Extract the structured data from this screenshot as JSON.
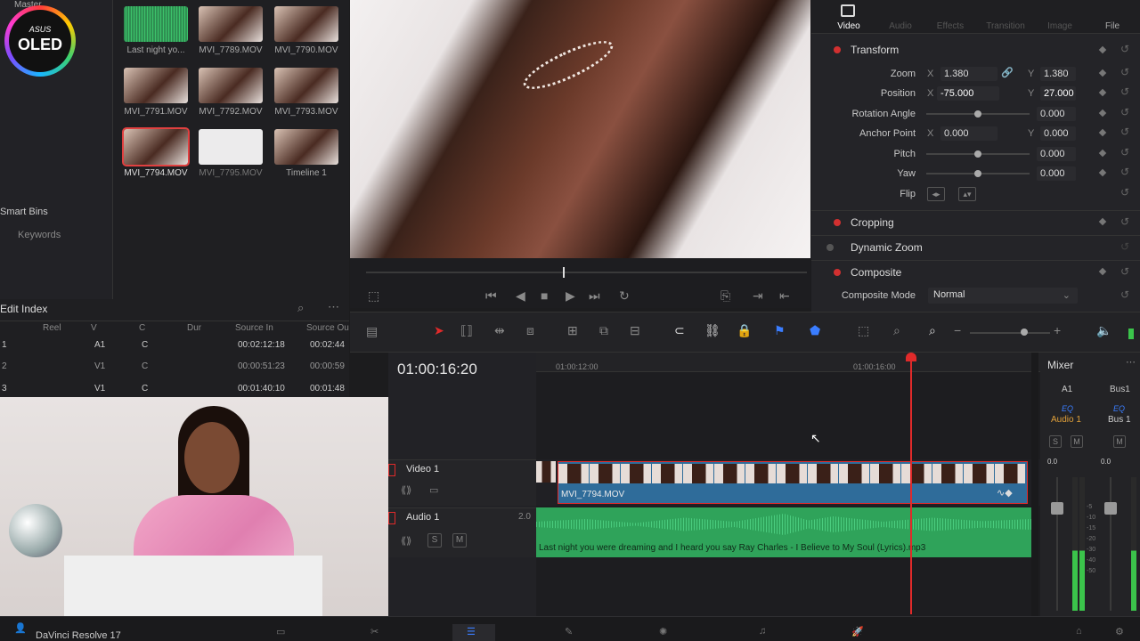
{
  "logo": {
    "brand": "ASUS",
    "product": "OLED"
  },
  "media_pool": {
    "header": "Master",
    "clips": [
      {
        "name": "Last night yo...",
        "kind": "audio"
      },
      {
        "name": "MVI_7789.MOV",
        "kind": "video"
      },
      {
        "name": "MVI_7790.MOV",
        "kind": "video"
      },
      {
        "name": "MVI_7791.MOV",
        "kind": "video"
      },
      {
        "name": "MVI_7792.MOV",
        "kind": "video"
      },
      {
        "name": "MVI_7793.MOV",
        "kind": "video"
      },
      {
        "name": "MVI_7794.MOV",
        "kind": "video",
        "selected": true
      },
      {
        "name": "MVI_7795.MOV",
        "kind": "white"
      },
      {
        "name": "Timeline 1",
        "kind": "timeline"
      }
    ],
    "smart_bins": "Smart Bins",
    "keywords": "Keywords"
  },
  "edit_index": {
    "title": "Edit Index",
    "columns": [
      "Reel",
      "V",
      "C",
      "Dur",
      "Source In",
      "Source Ou"
    ],
    "rows": [
      {
        "n": "1",
        "v": "A1",
        "c": "C",
        "in": "00:02:12:18",
        "out": "00:02:44"
      },
      {
        "n": "2",
        "v": "V1",
        "c": "C",
        "in": "00:00:51:23",
        "out": "00:00:59"
      },
      {
        "n": "3",
        "v": "V1",
        "c": "C",
        "in": "00:01:40:10",
        "out": "00:01:48"
      }
    ]
  },
  "inspector": {
    "tabs": [
      "Video",
      "Audio",
      "Effects",
      "Transition",
      "Image",
      "File"
    ],
    "active_tab": "Video",
    "transform": "Transform",
    "zoom": {
      "label": "Zoom",
      "x": "1.380",
      "y": "1.380"
    },
    "position": {
      "label": "Position",
      "x": "-75.000",
      "y": "27.000"
    },
    "rotation": {
      "label": "Rotation Angle",
      "value": "0.000"
    },
    "anchor": {
      "label": "Anchor Point",
      "x": "0.000",
      "y": "0.000"
    },
    "pitch": {
      "label": "Pitch",
      "value": "0.000"
    },
    "yaw": {
      "label": "Yaw",
      "value": "0.000"
    },
    "flip": "Flip",
    "x_label": "X",
    "y_label": "Y",
    "cropping": "Cropping",
    "dynamic_zoom": "Dynamic Zoom",
    "composite": "Composite",
    "composite_mode": {
      "label": "Composite Mode",
      "value": "Normal"
    }
  },
  "timeline": {
    "timecode": "01:00:16:20",
    "ruler": [
      "01:00:12:00",
      "01:00:16:00"
    ],
    "video_track": "Video 1",
    "audio_track": "Audio 1",
    "audio_level": "2.0",
    "video_clip": "MVI_7794.MOV",
    "audio_clip": "Last night you were dreaming and I heard you say  Ray Charles - I Believe to My Soul (Lyrics).mp3",
    "solo": "S",
    "mute": "M"
  },
  "mixer": {
    "title": "Mixer",
    "channels": [
      "A1",
      "Bus1"
    ],
    "eq": "EQ",
    "strip_names": [
      "Audio 1",
      "Bus 1"
    ],
    "db": [
      "0.0",
      "0.0"
    ],
    "scale": [
      "0",
      "-5",
      "-10",
      "-15",
      "-20",
      "-30",
      "-40",
      "-50"
    ],
    "solo": "S",
    "mute": "M"
  },
  "taskbar": {
    "app": "DaVinci Resolve 17"
  },
  "colors": {
    "accent_red": "#e02a2a",
    "clip_blue": "#2f6c9a",
    "audio_green": "#2fa35a",
    "playhead": "#e02a2a"
  }
}
